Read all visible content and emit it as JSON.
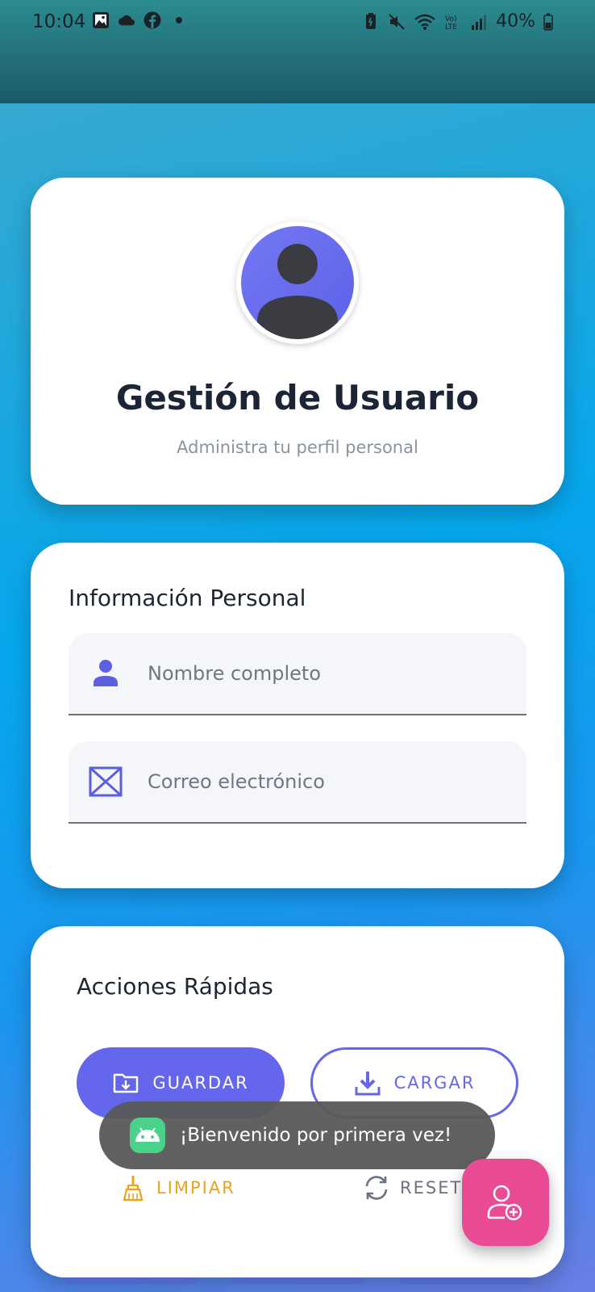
{
  "status_bar": {
    "time": "10:04",
    "battery": "40%",
    "left_icons": [
      "gallery-icon",
      "cloud-icon",
      "facebook-icon",
      "dot-icon"
    ],
    "right_icons": [
      "battery-saver-icon",
      "mute-icon",
      "wifi-icon",
      "volte-icon",
      "signal-icon",
      "battery-icon"
    ]
  },
  "profile": {
    "avatar_icon": "person-icon",
    "title": "Gestión de Usuario",
    "subtitle": "Administra tu perfil personal"
  },
  "personal_info": {
    "title": "Información Personal",
    "name_placeholder": "Nombre completo",
    "name_icon": "person-icon",
    "email_placeholder": "Correo electrónico",
    "email_icon": "mail-icon"
  },
  "quick_actions": {
    "title": "Acciones Rápidas",
    "save_label": "GUARDAR",
    "load_label": "CARGAR",
    "clear_label": "LIMPIAR",
    "reset_label": "RESET"
  },
  "toast": {
    "message": "¡Bienvenido por primera vez!",
    "icon": "android-icon"
  },
  "fab": {
    "icon": "add-user-icon"
  },
  "colors": {
    "accent": "#6466ec",
    "fab": "#e94b94",
    "clear": "#e8a41b",
    "toast_bg": "#585858"
  }
}
